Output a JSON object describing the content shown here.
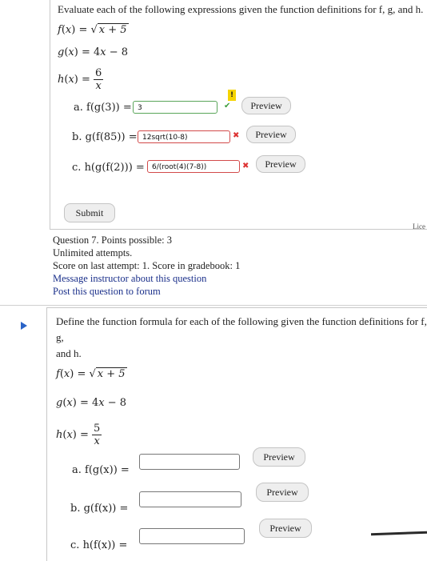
{
  "question6": {
    "prompt": "Evaluate each of the following expressions given the function definitions for f, g, and h.",
    "f": "f(x) = √x + 5",
    "g": "g(x) = 4x − 8",
    "h_numerator": "6",
    "parts": [
      {
        "label": "a.",
        "expr": "f(g(3)) =",
        "answer": "3",
        "status": "correct",
        "preview": "Preview"
      },
      {
        "label": "b.",
        "expr": "g(f(85)) =",
        "answer": "12sqrt(10-8)",
        "status": "incorrect",
        "preview": "Preview"
      },
      {
        "label": "c.",
        "expr": "h(g(f(2))) =",
        "answer": "6/(root(4)(7-8))",
        "status": "incorrect",
        "preview": "Preview"
      }
    ],
    "submit": "Submit"
  },
  "question7_info": {
    "line1": "Question 7. Points possible: 3",
    "line2": "Unlimited attempts.",
    "line3": "Score on last attempt: 1. Score in gradebook: 1",
    "message_link": "Message instructor about this question",
    "forum_link": "Post this question to forum",
    "license_text": "Lice"
  },
  "question8": {
    "prompt_line1": "Define the function formula for each of the following given the function definitions for f, g,",
    "prompt_line2": "and h.",
    "f": "f(x) = √x + 5",
    "g": "g(x) = 4x − 8",
    "h_numerator": "5",
    "parts": [
      {
        "label": "a.",
        "expr": "f(g(x)) =",
        "answer": "",
        "preview": "Preview"
      },
      {
        "label": "b.",
        "expr": "g(f(x)) =",
        "answer": "",
        "preview": "Preview"
      },
      {
        "label": "c.",
        "expr": "h(f(x)) =",
        "answer": "",
        "preview": "Preview"
      }
    ]
  },
  "colors": {
    "correct": "#3e9e3e",
    "incorrect": "#d33333",
    "link": "#1a2f8a",
    "hint_flag": "#f5d400"
  }
}
